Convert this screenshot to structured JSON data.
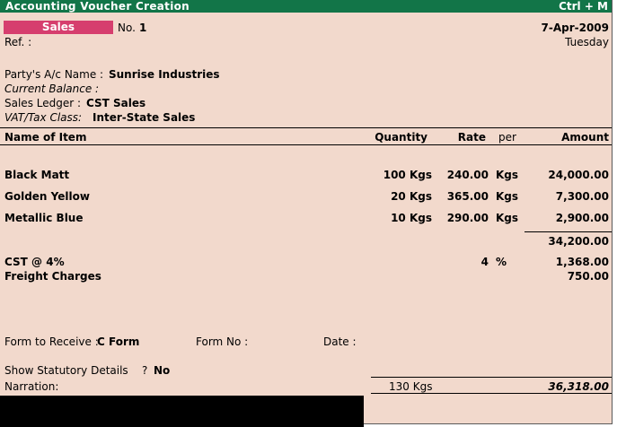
{
  "window": {
    "title": "Accounting Voucher  Creation",
    "shortcut": "Ctrl + M"
  },
  "voucher": {
    "type": "Sales",
    "no_label": "No.",
    "no_value": "1",
    "date": "7-Apr-2009",
    "day": "Tuesday",
    "ref_label": "Ref. :"
  },
  "party": {
    "name_label": "Party's A/c Name :",
    "name_value": "Sunrise Industries",
    "balance_label": "Current Balance :",
    "ledger_label": "Sales Ledger :",
    "ledger_value": "CST Sales",
    "vat_label": "VAT/Tax Class:",
    "vat_value": "Inter-State Sales"
  },
  "columns": {
    "item": "Name of Item",
    "quantity": "Quantity",
    "rate": "Rate",
    "per": "per",
    "amount": "Amount"
  },
  "items": [
    {
      "name": "Black Matt",
      "quantity": "100 Kgs",
      "rate": "240.00",
      "per": "Kgs",
      "amount": "24,000.00"
    },
    {
      "name": "Golden Yellow",
      "quantity": "20 Kgs",
      "rate": "365.00",
      "per": "Kgs",
      "amount": "7,300.00"
    },
    {
      "name": "Metallic Blue",
      "quantity": "10 Kgs",
      "rate": "290.00",
      "per": "Kgs",
      "amount": "2,900.00"
    }
  ],
  "subtotal": "34,200.00",
  "tax": {
    "name": "CST @ 4%",
    "rate": "4",
    "per": "%",
    "amount": "1,368.00"
  },
  "freight": {
    "name": "Freight Charges",
    "amount": "750.00"
  },
  "form": {
    "receive_label": "Form to Receive :",
    "receive_value": "C Form",
    "no_label": "Form No :",
    "date_label": "Date :"
  },
  "statutory": {
    "label": "Show Statutory Details",
    "q": "?",
    "value": "No"
  },
  "narration_label": "Narration:",
  "totals": {
    "quantity": "130 Kgs",
    "amount": "36,318.00"
  }
}
